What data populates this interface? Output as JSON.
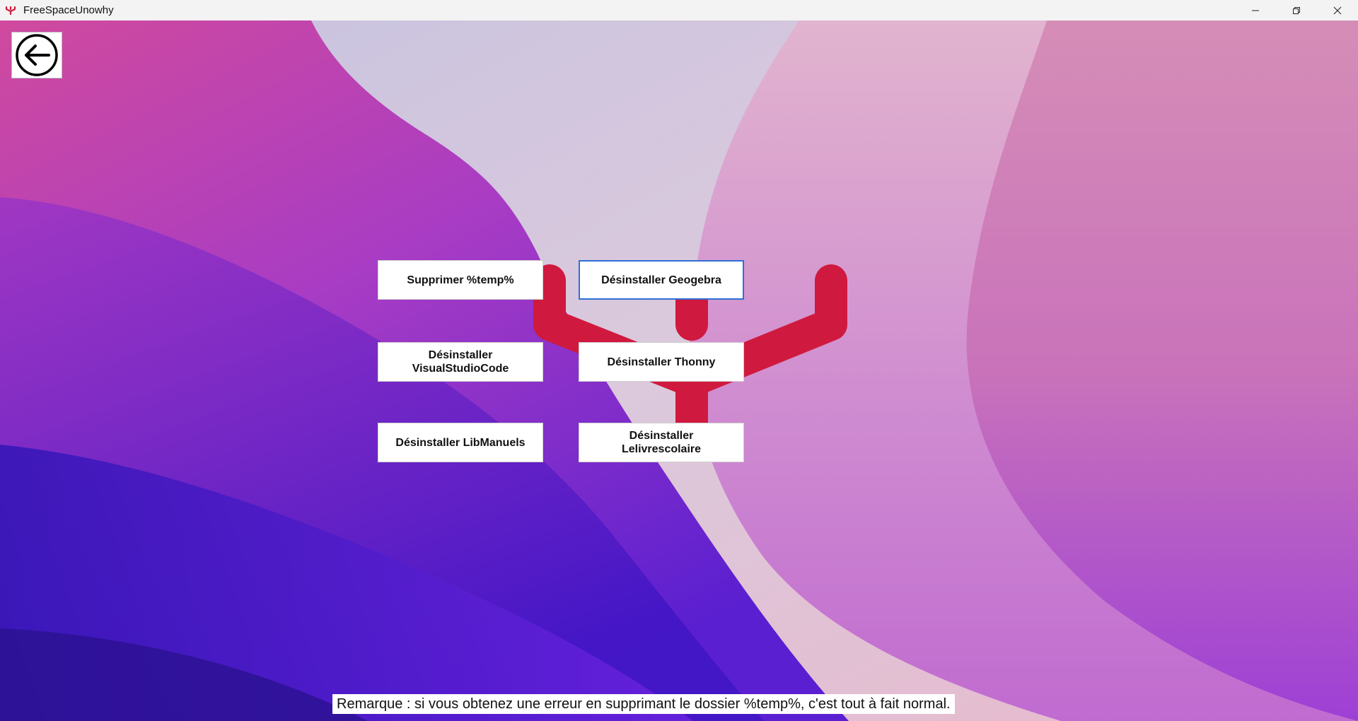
{
  "window": {
    "title": "FreeSpaceUnowhy",
    "controls": [
      "minimize",
      "restore",
      "close"
    ]
  },
  "colors": {
    "logo_red": "#d0193e",
    "focus_border": "#2f6fd6",
    "button_bg": "#ffffff"
  },
  "back_button": {
    "icon": "arrow-left-circle-icon"
  },
  "actions": {
    "delete_temp": "Supprimer %temp%",
    "uninstall_geogebra": "Désinstaller Geogebra",
    "uninstall_vscode_line1": "Désinstaller",
    "uninstall_vscode_line2": "VisualStudioCode",
    "uninstall_thonny": "Désinstaller Thonny",
    "uninstall_libmanuels": "Désinstaller LibManuels",
    "uninstall_lelivrescolaire_line1": "Désinstaller",
    "uninstall_lelivrescolaire_line2": "Lelivrescolaire"
  },
  "note": "Remarque : si vous obtenez une erreur en supprimant le dossier %temp%, c'est tout à fait normal."
}
